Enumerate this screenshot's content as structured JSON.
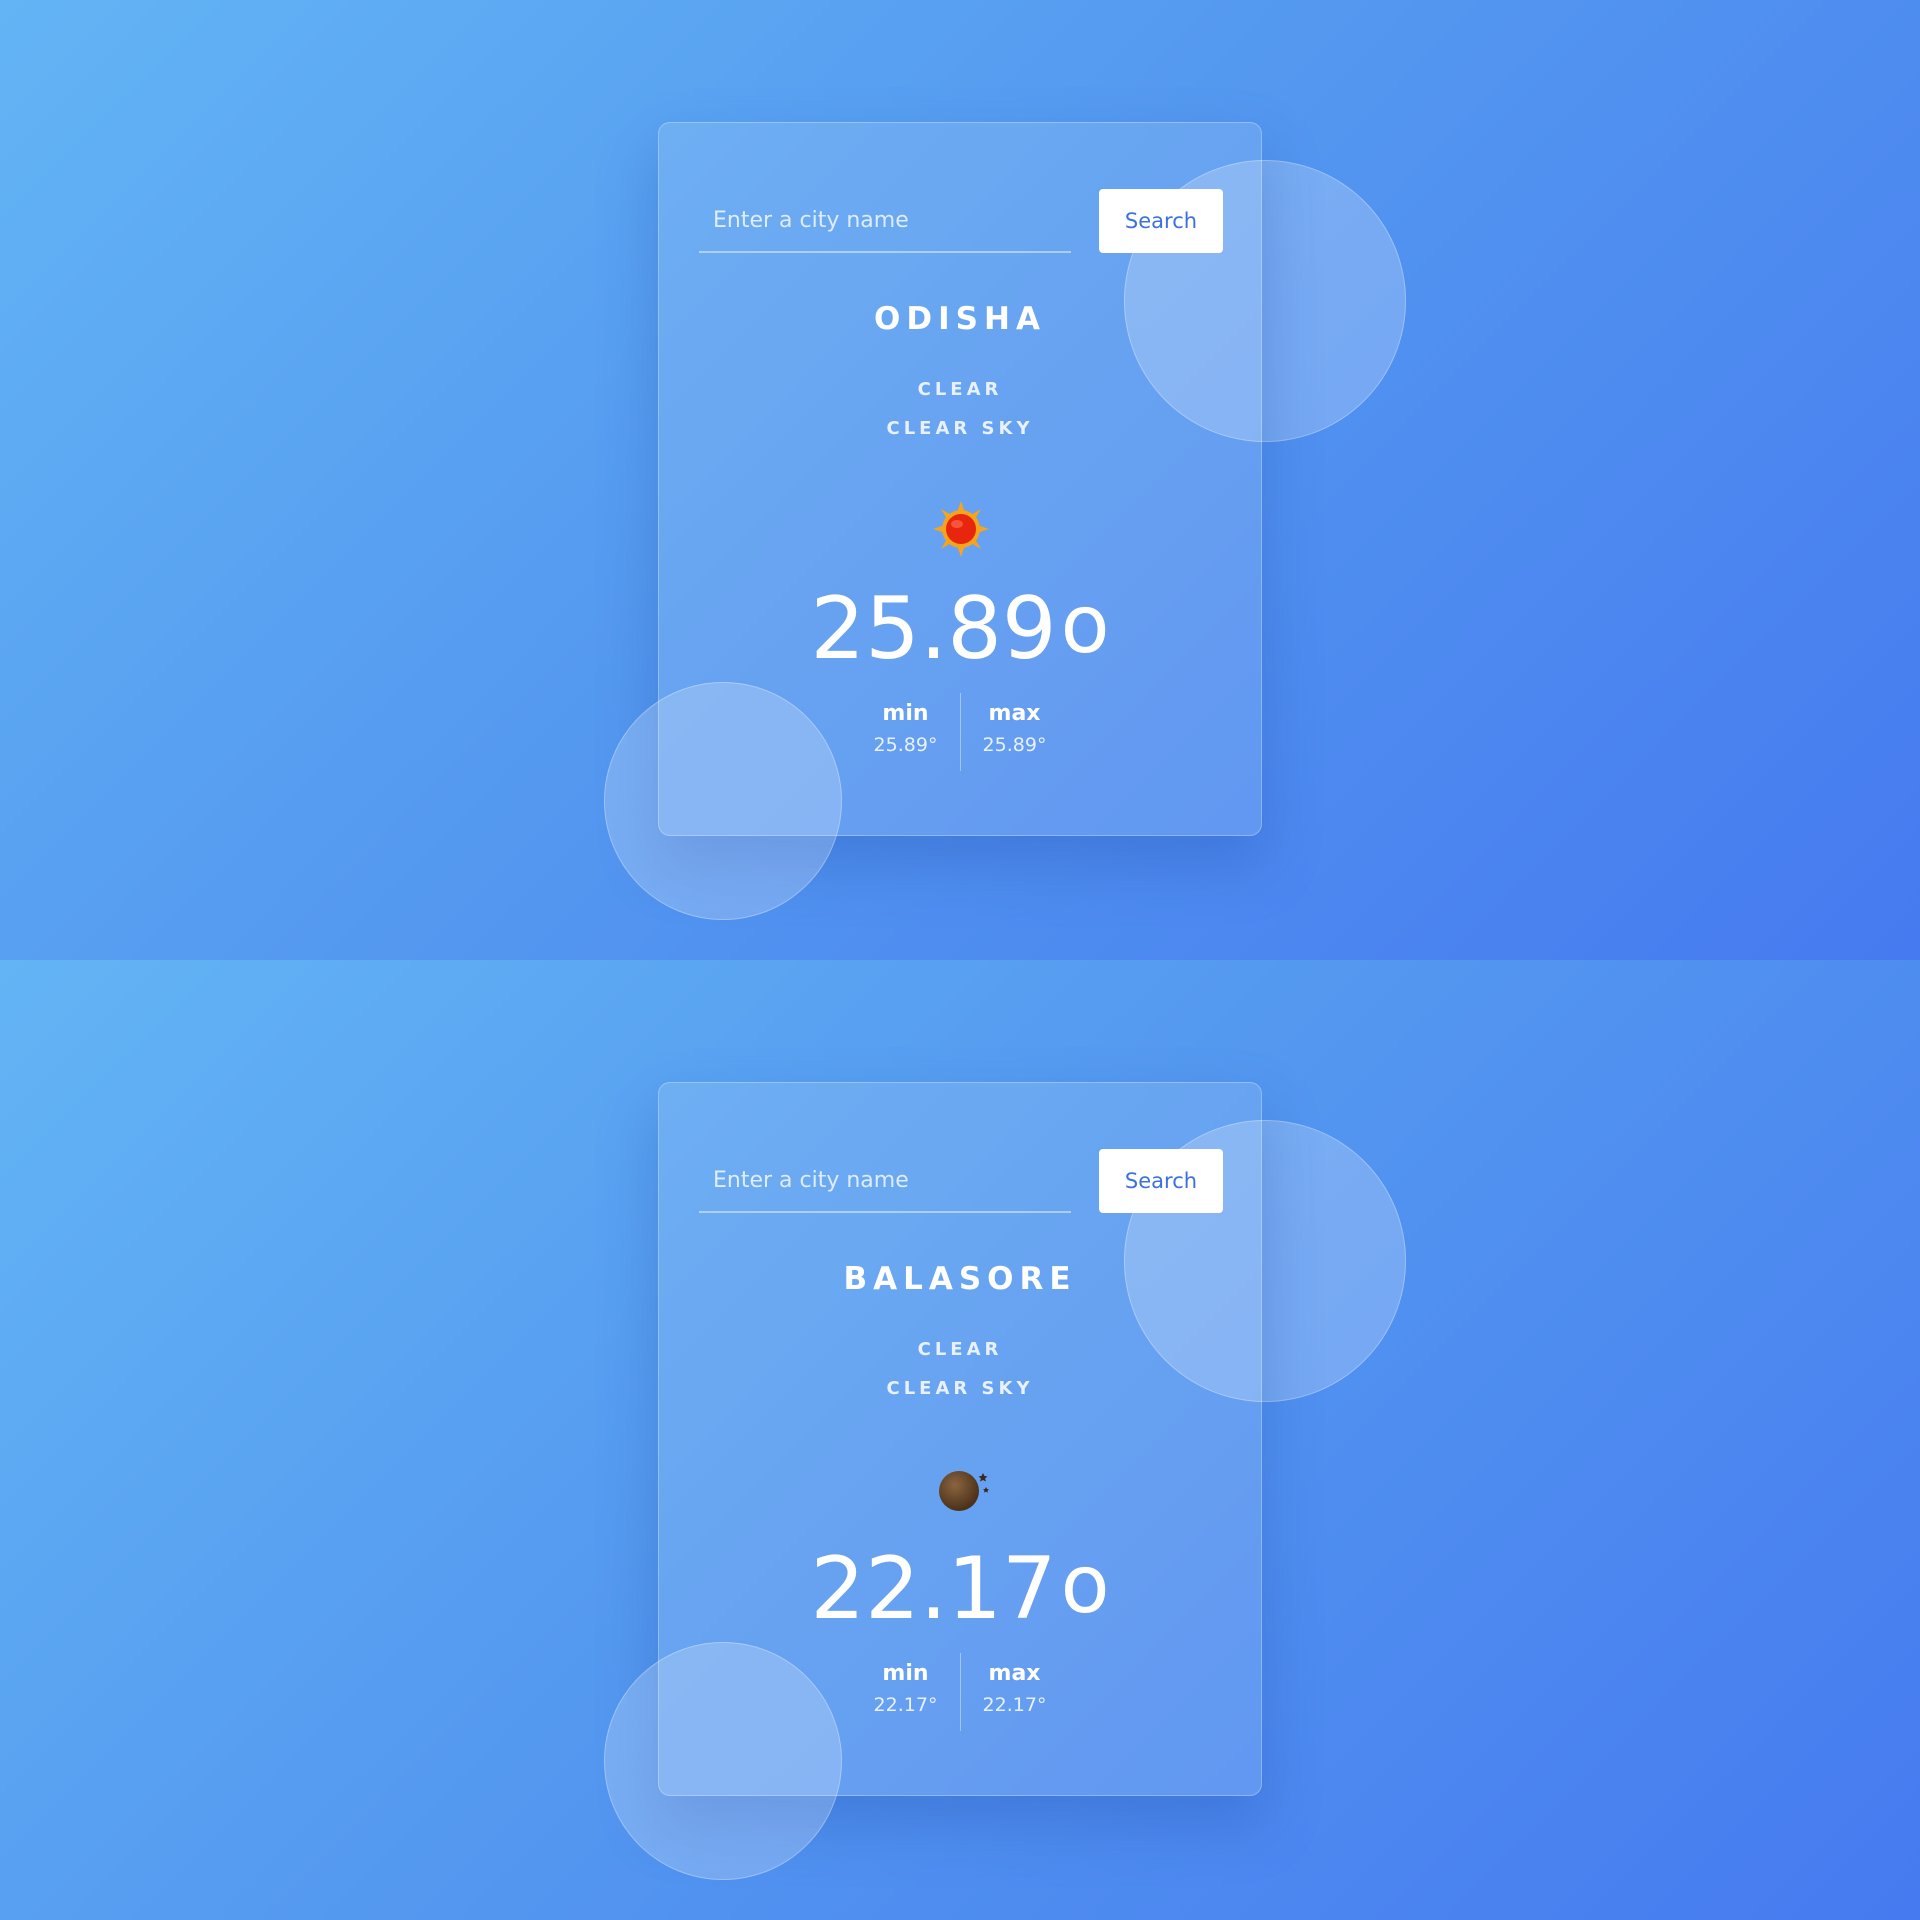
{
  "panels": [
    {
      "search": {
        "placeholder": "Enter a city name",
        "button_label": "Search"
      },
      "city": "ODISHA",
      "weather_main": "CLEAR",
      "weather_desc": "CLEAR SKY",
      "weather_icon": "sun-icon",
      "temperature": "25.89",
      "degree_symbol": "o",
      "min_label": "min",
      "min_value": "25.89°",
      "max_label": "max",
      "max_value": "25.89°"
    },
    {
      "search": {
        "placeholder": "Enter a city name",
        "button_label": "Search"
      },
      "city": "BALASORE",
      "weather_main": "CLEAR",
      "weather_desc": "CLEAR SKY",
      "weather_icon": "moon-stars-icon",
      "temperature": "22.17",
      "degree_symbol": "o",
      "min_label": "min",
      "min_value": "22.17°",
      "max_label": "max",
      "max_value": "22.17°"
    }
  ],
  "colors": {
    "background_start": "#63b4f5",
    "background_end": "#467af0",
    "button_text": "#3c6fe0",
    "sun_core": "#e8250e",
    "sun_rays": "#f7a31c",
    "moon": "#6b4a2e"
  }
}
